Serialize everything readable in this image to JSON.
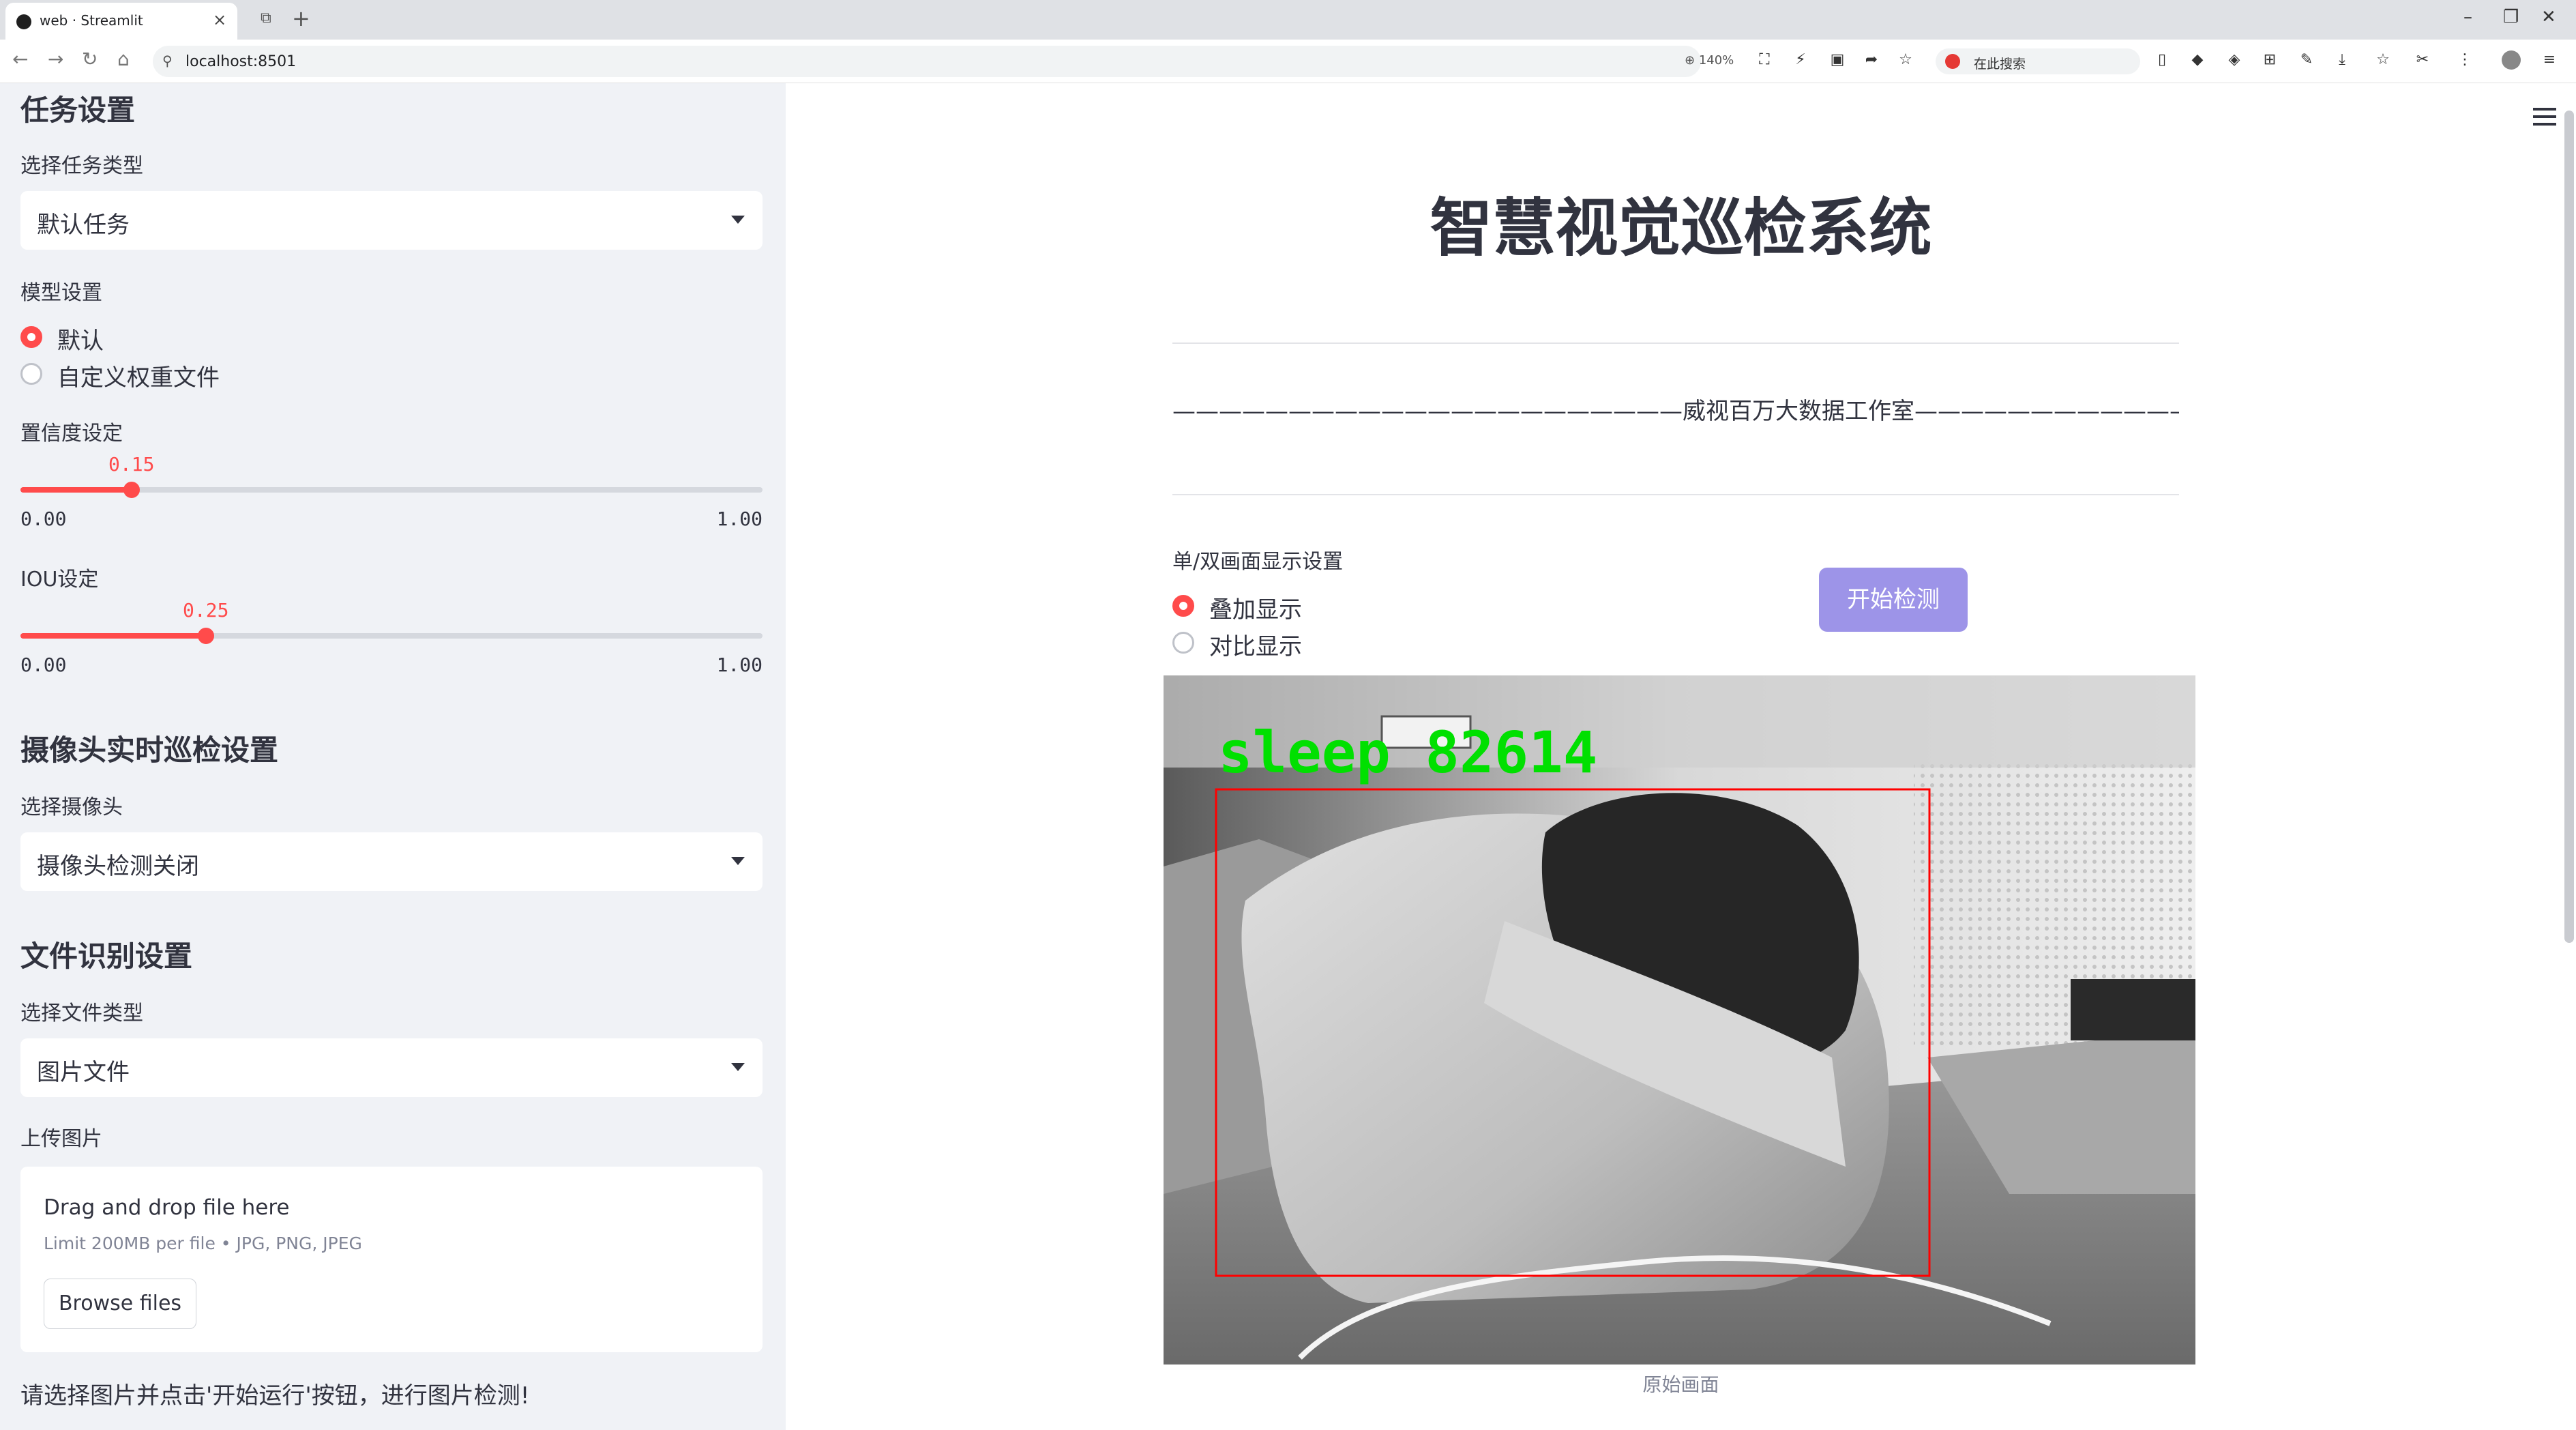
{
  "browser": {
    "tab_title": "web · Streamlit",
    "url": "localhost:8501",
    "zoom": "140%",
    "search_placeholder": "在此搜索"
  },
  "sidebar": {
    "task_heading": "任务设置",
    "task_type_label": "选择任务类型",
    "task_type_value": "默认任务",
    "model_label": "模型设置",
    "model_options": [
      "默认",
      "自定义权重文件"
    ],
    "model_selected": "默认",
    "conf_label": "置信度设定",
    "conf": {
      "value": "0.15",
      "min": "0.00",
      "max": "1.00",
      "level": 0.15
    },
    "iou_label": "IOU设定",
    "iou": {
      "value": "0.25",
      "min": "0.00",
      "max": "1.00",
      "level": 0.25
    },
    "camera_heading": "摄像头实时巡检设置",
    "camera_label": "选择摄像头",
    "camera_value": "摄像头检测关闭",
    "file_heading": "文件识别设置",
    "file_type_label": "选择文件类型",
    "file_type_value": "图片文件",
    "upload_label": "上传图片",
    "dropzone_title": "Drag and drop file here",
    "dropzone_limit": "Limit 200MB per file • JPG, PNG, JPEG",
    "browse_button": "Browse files",
    "note": "请选择图片并点击'开始运行'按钮，进行图片检测!"
  },
  "main": {
    "title": "智慧视觉巡检系统",
    "subtitle": "——————————————————————威视百万大数据工作室———————————————————————",
    "display_mode_label": "单/双画面显示设置",
    "display_options": [
      "叠加显示",
      "对比显示"
    ],
    "display_selected": "叠加显示",
    "start_button": "开始检测",
    "detection_label": "sleep 82614",
    "image_caption": "原始画面"
  },
  "colors": {
    "accent": "#ff4b4b",
    "button": "#9d94e8",
    "sidebar_bg": "#f0f2f6",
    "detection_box": "#ff0000",
    "detection_text": "#00e000"
  }
}
